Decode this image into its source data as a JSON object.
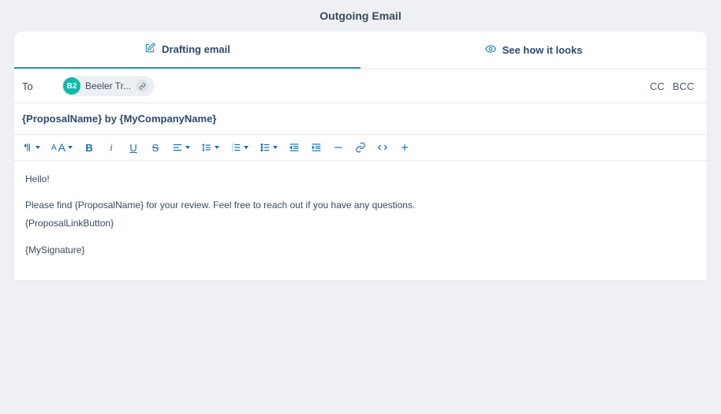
{
  "header": {
    "title": "Outgoing Email"
  },
  "tabs": {
    "draft": "Drafting email",
    "preview": "See how it looks"
  },
  "to": {
    "label": "To",
    "chip": {
      "avatar": "B2",
      "name": "Beeler Tr..."
    },
    "cc": "CC",
    "bcc": "BCC"
  },
  "subject": "{ProposalName} by {MyCompanyName}",
  "body": {
    "p1": "Hello!",
    "p2": "Please find {ProposalName} for your review. Feel free to reach out if you have any questions.",
    "p3": "{ProposalLinkButton}",
    "p4": "{MySignature}"
  }
}
